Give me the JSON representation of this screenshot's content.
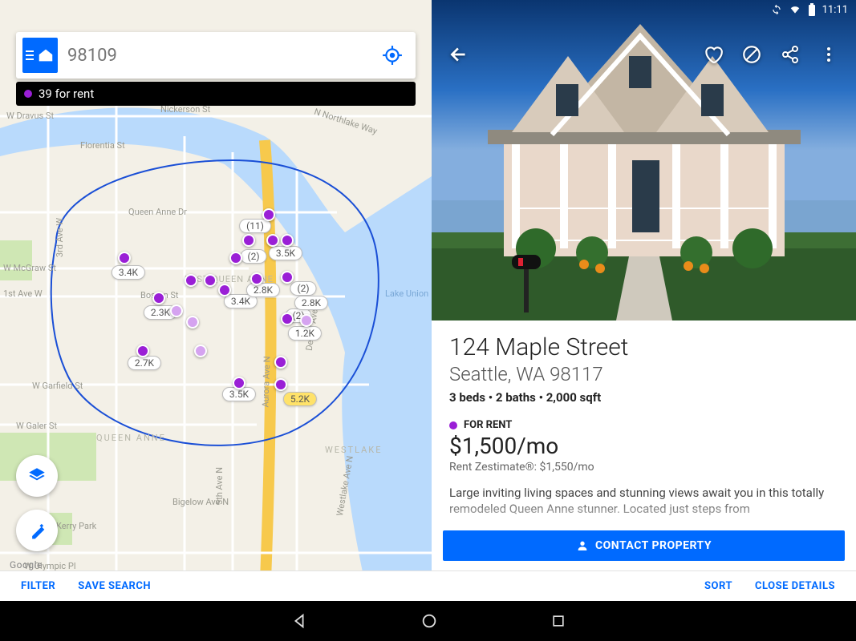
{
  "status": {
    "time": "11:11"
  },
  "search": {
    "placeholder": "98109"
  },
  "results": {
    "count_label": "39 for rent"
  },
  "map": {
    "buttons": {
      "filter": "FILTER",
      "save": "SAVE SEARCH"
    },
    "attribution": "Google",
    "streets": [
      "W Dravus St",
      "Nickerson St",
      "N Northlake Way",
      "Florentia St",
      "Queen Anne Dr",
      "3rd Ave W",
      "W McGraw St",
      "Boston St",
      "Dexter Ave N",
      "Aurora Ave N",
      "W Garfield St",
      "W Galer St",
      "QUEEN ANNE",
      "EAST QUEEN ANNE",
      "Lake Union",
      "Kerry Park",
      "Bigelow Ave N",
      "Westlake Ave N",
      "WESTLAKE",
      "W Olympic Pl",
      "1st Ave W",
      "5th Ave N"
    ],
    "cluster_pills": [
      "(11)",
      "(2)",
      "(2)",
      "(2)"
    ],
    "price_pills": [
      "3.4K",
      "2.3K",
      "2.7K",
      "3.5K",
      "3.4K",
      "2.8K",
      "1.2K",
      "5.2K",
      "2.8K",
      "3.5K"
    ]
  },
  "detail": {
    "address": "124 Maple Street",
    "city_state": "Seattle, WA 98117",
    "stats": "3 beds • 2 baths • 2,000 sqft",
    "status_label": "FOR RENT",
    "price": "$1,500/mo",
    "zestimate": "Rent Zestimate®: $1,550/mo",
    "description": "Large inviting living spaces and stunning views await you in this totally remodeled Queen Anne stunner. Located just steps from",
    "contact": "CONTACT PROPERTY",
    "buttons": {
      "sort": "SORT",
      "close": "CLOSE DETAILS"
    }
  }
}
